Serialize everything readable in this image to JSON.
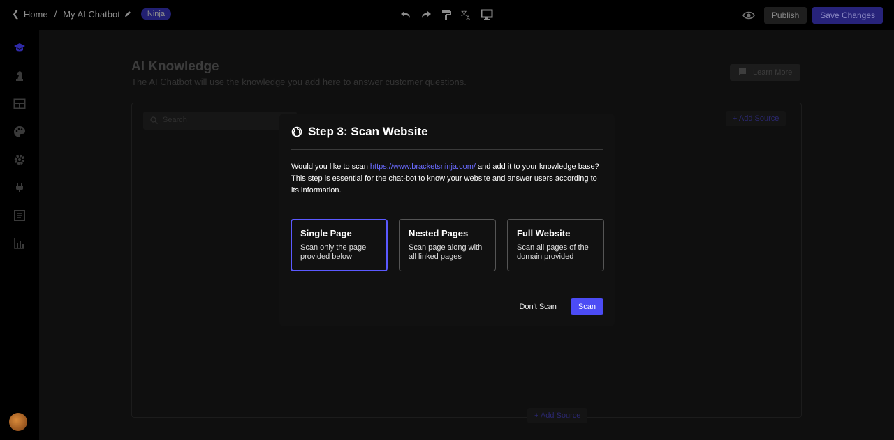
{
  "topbar": {
    "back_label": "Home",
    "separator": "/",
    "project_name": "My AI Chatbot",
    "badge": "Ninja",
    "tools": [
      "undo-icon",
      "redo-icon",
      "format-paint-icon",
      "translate-icon",
      "monitor-icon"
    ],
    "preview_icon": "eye-icon",
    "publish_label": "Publish",
    "save_label": "Save Changes"
  },
  "sidebar": {
    "items": [
      "graduation-cap-icon",
      "knight-icon",
      "table-icon",
      "palette-icon",
      "gear-icon",
      "plug-icon",
      "document-icon",
      "bar-chart-icon"
    ],
    "avatar": "avatar"
  },
  "main": {
    "title": "AI Knowledge",
    "subtitle": "The AI Chatbot will use the knowledge you add here to answer customer questions.",
    "learn_more": "Learn More",
    "search_placeholder": "Search",
    "add_source_top": "Add Source",
    "add_source_bottom": "Add Source"
  },
  "modal": {
    "title": "Step 3: Scan Website",
    "intro_before": "Would you like to scan ",
    "url": "https://www.bracketsninja.com/",
    "intro_after": " and add it to your knowledge base?",
    "explanation": "This step is essential for the chat-bot to know your website and answer users according to its information.",
    "options": [
      {
        "title": "Single Page",
        "desc": "Scan only the page provided below",
        "selected": true
      },
      {
        "title": "Nested Pages",
        "desc": "Scan page along with all linked pages",
        "selected": false
      },
      {
        "title": "Full Website",
        "desc": "Scan all pages of the domain provided",
        "selected": false
      }
    ],
    "dont_scan_label": "Don't Scan",
    "scan_label": "Scan"
  },
  "colors": {
    "accent": "#4c4cf5",
    "selected_border": "#5b59ff",
    "link": "#6a6bff",
    "modal_bg": "#111111"
  }
}
